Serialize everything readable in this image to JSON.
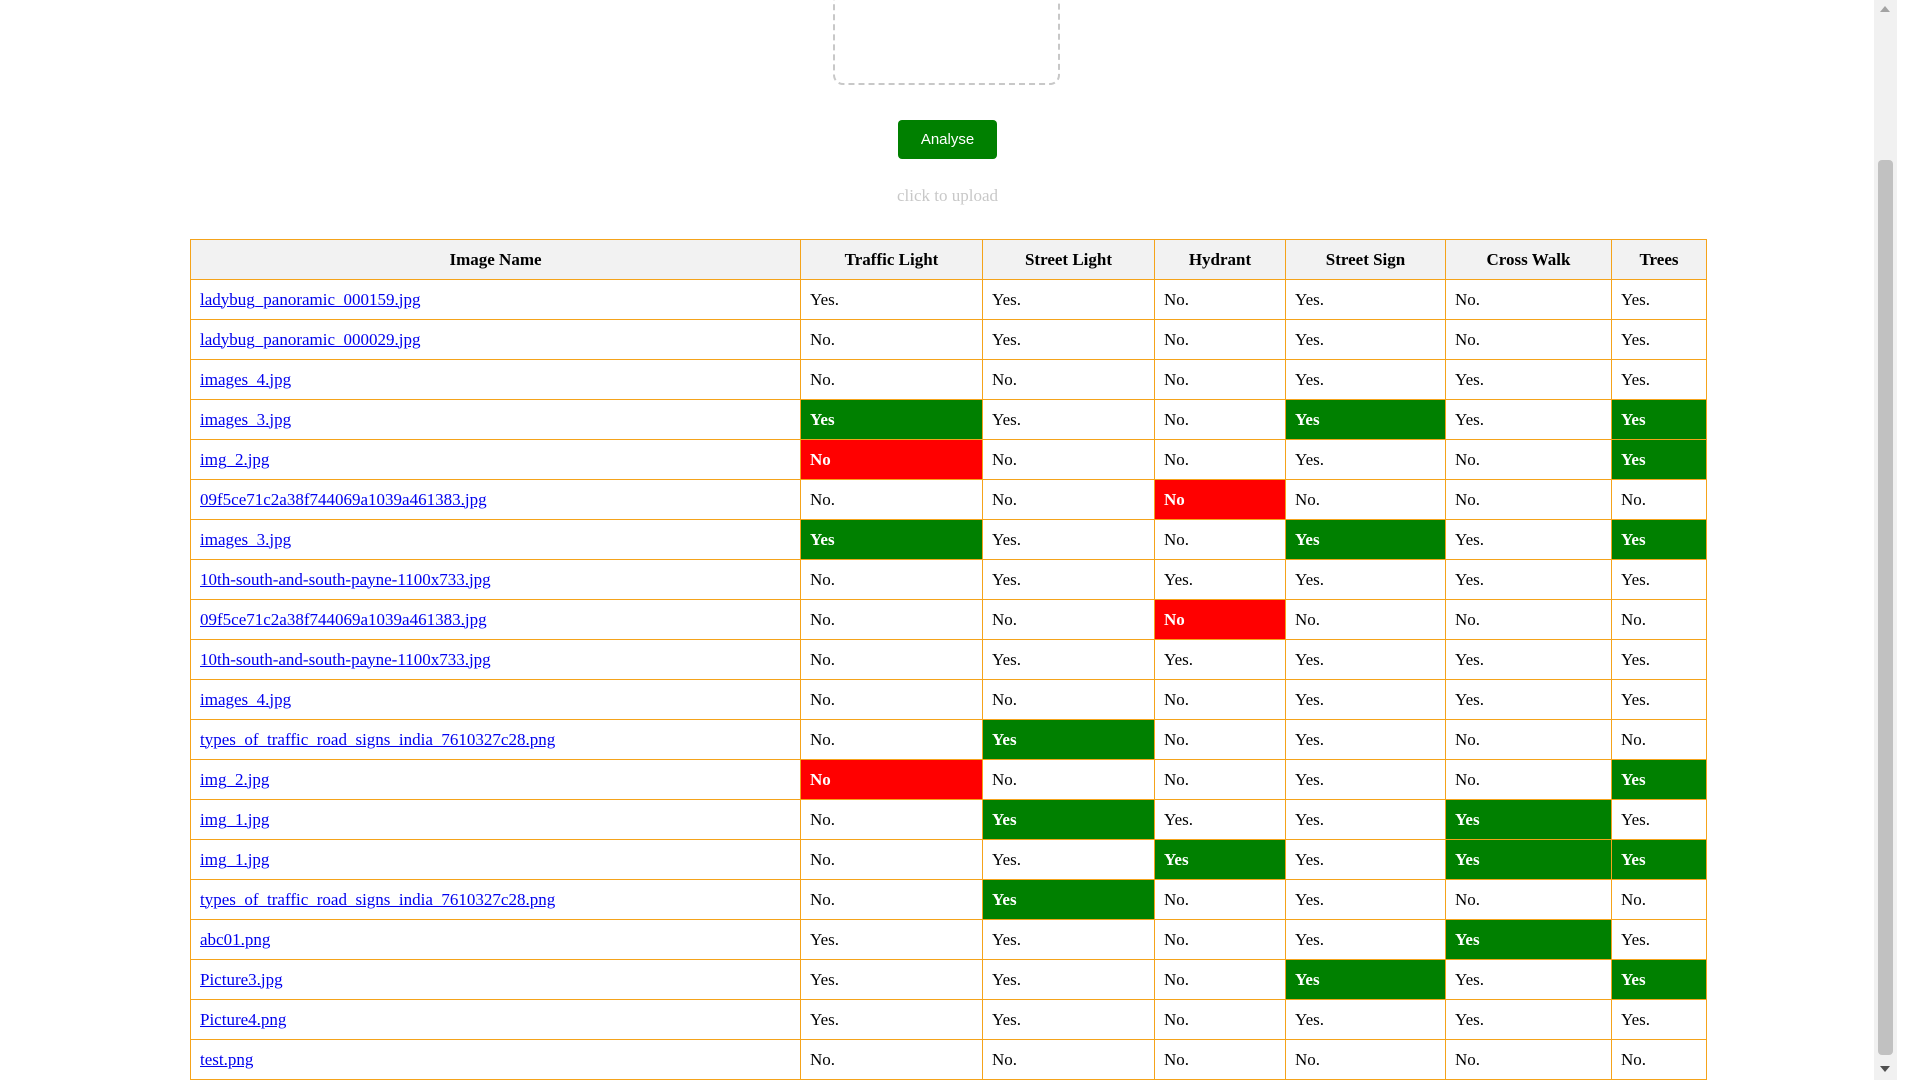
{
  "upload": {
    "analyse_label": "Analyse",
    "hint": "click to upload"
  },
  "table": {
    "columns": [
      "Image Name",
      "Traffic Light",
      "Street Light",
      "Hydrant",
      "Street Sign",
      "Cross Walk",
      "Trees"
    ],
    "rows": [
      {
        "name": "ladybug_panoramic_000159.jpg",
        "cells": [
          "Yes.",
          "Yes.",
          "No.",
          "Yes.",
          "No.",
          "Yes."
        ]
      },
      {
        "name": "ladybug_panoramic_000029.jpg",
        "cells": [
          "No.",
          "Yes.",
          "No.",
          "Yes.",
          "No.",
          "Yes."
        ]
      },
      {
        "name": "images_4.jpg",
        "cells": [
          "No.",
          "No.",
          "No.",
          "Yes.",
          "Yes.",
          "Yes."
        ]
      },
      {
        "name": "images_3.jpg",
        "cells": [
          "Yes",
          "Yes.",
          "No.",
          "Yes",
          "Yes.",
          "Yes"
        ]
      },
      {
        "name": "img_2.jpg",
        "cells": [
          "No",
          "No.",
          "No.",
          "Yes.",
          "No.",
          "Yes"
        ]
      },
      {
        "name": "09f5ce71c2a38f744069a1039a461383.jpg",
        "cells": [
          "No.",
          "No.",
          "No",
          "No.",
          "No.",
          "No."
        ]
      },
      {
        "name": "images_3.jpg",
        "cells": [
          "Yes",
          "Yes.",
          "No.",
          "Yes",
          "Yes.",
          "Yes"
        ]
      },
      {
        "name": "10th-south-and-south-payne-1100x733.jpg",
        "cells": [
          "No.",
          "Yes.",
          "Yes.",
          "Yes.",
          "Yes.",
          "Yes."
        ]
      },
      {
        "name": "09f5ce71c2a38f744069a1039a461383.jpg",
        "cells": [
          "No.",
          "No.",
          "No",
          "No.",
          "No.",
          "No."
        ]
      },
      {
        "name": "10th-south-and-south-payne-1100x733.jpg",
        "cells": [
          "No.",
          "Yes.",
          "Yes.",
          "Yes.",
          "Yes.",
          "Yes."
        ]
      },
      {
        "name": "images_4.jpg",
        "cells": [
          "No.",
          "No.",
          "No.",
          "Yes.",
          "Yes.",
          "Yes."
        ]
      },
      {
        "name": "types_of_traffic_road_signs_india_7610327c28.png",
        "cells": [
          "No.",
          "Yes",
          "No.",
          "Yes.",
          "No.",
          "No."
        ]
      },
      {
        "name": "img_2.jpg",
        "cells": [
          "No",
          "No.",
          "No.",
          "Yes.",
          "No.",
          "Yes"
        ]
      },
      {
        "name": "img_1.jpg",
        "cells": [
          "No.",
          "Yes",
          "Yes.",
          "Yes.",
          "Yes",
          "Yes."
        ]
      },
      {
        "name": "img_1.jpg",
        "cells": [
          "No.",
          "Yes.",
          "Yes",
          "Yes.",
          "Yes",
          "Yes"
        ]
      },
      {
        "name": "types_of_traffic_road_signs_india_7610327c28.png",
        "cells": [
          "No.",
          "Yes",
          "No.",
          "Yes.",
          "No.",
          "No."
        ]
      },
      {
        "name": "abc01.png",
        "cells": [
          "Yes.",
          "Yes.",
          "No.",
          "Yes.",
          "Yes",
          "Yes."
        ]
      },
      {
        "name": "Picture3.jpg",
        "cells": [
          "Yes.",
          "Yes.",
          "No.",
          "Yes",
          "Yes.",
          "Yes"
        ]
      },
      {
        "name": "Picture4.png",
        "cells": [
          "Yes.",
          "Yes.",
          "No.",
          "Yes.",
          "Yes.",
          "Yes."
        ]
      },
      {
        "name": "test.png",
        "cells": [
          "No.",
          "No.",
          "No.",
          "No.",
          "No.",
          "No."
        ]
      }
    ]
  },
  "colors": {
    "highlight_yes": "#008000",
    "highlight_no": "#ff0000",
    "table_border": "#f5a31a"
  }
}
